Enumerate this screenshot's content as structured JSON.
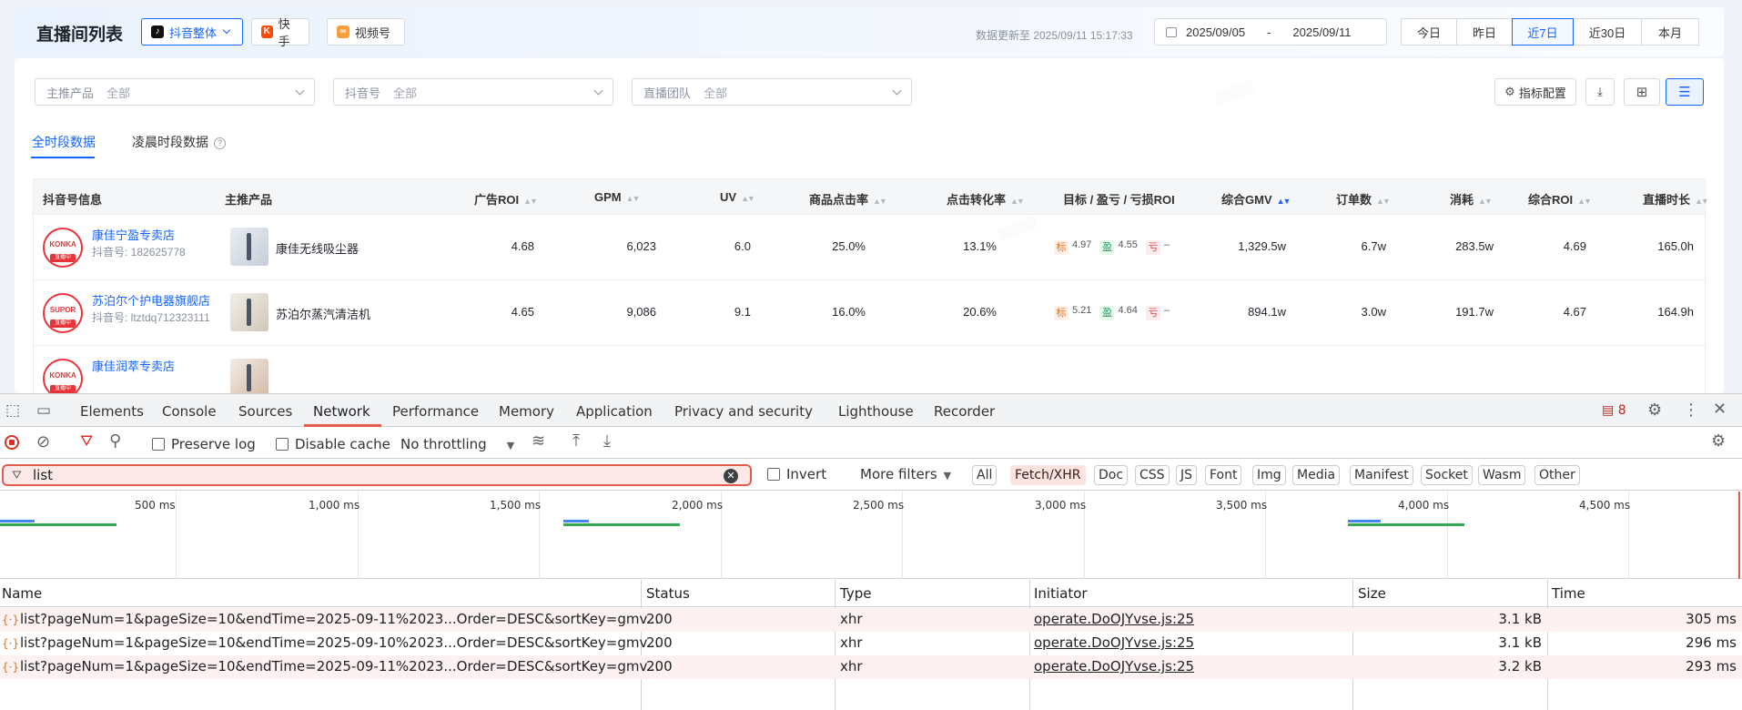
{
  "header": {
    "title": "直播间列表",
    "platforms": [
      {
        "label": "抖音整体",
        "icon": "douyin-icon",
        "color": "#111111"
      },
      {
        "label": "快手",
        "icon": "kuaishou-icon",
        "color": "#ff4906"
      },
      {
        "label": "视频号",
        "icon": "channels-icon",
        "color": "#fa9d3b"
      }
    ],
    "update_text": "数据更新至 2025/09/11 15:17:33",
    "date_start": "2025/09/05",
    "date_sep": "-",
    "date_end": "2025/09/11",
    "ranges": [
      "今日",
      "昨日",
      "近7日",
      "近30日",
      "本月"
    ],
    "active_range": "近7日"
  },
  "filters": [
    {
      "label": "主推产品",
      "value": "全部"
    },
    {
      "label": "抖音号",
      "value": "全部"
    },
    {
      "label": "直播团队",
      "value": "全部"
    }
  ],
  "toolbar": {
    "metric_config": "指标配置"
  },
  "tabs": [
    "全时段数据",
    "凌晨时段数据"
  ],
  "table": {
    "columns": [
      "抖音号信息",
      "主推产品",
      "广告ROI",
      "GPM",
      "UV",
      "商品点击率",
      "点击转化率",
      "目标 / 盈亏 / 亏损ROI",
      "综合GMV",
      "订单数",
      "消耗",
      "综合ROI",
      "直播时长"
    ],
    "rows": [
      {
        "logo": "KONKA",
        "logo_badge": "直播中",
        "name": "康佳宁盈专卖店",
        "id": "抖音号: 182625778",
        "product": "康佳无线吸尘器",
        "ad_roi": "4.68",
        "gpm": "6,023",
        "uv": "6.0",
        "ctr": "25.0%",
        "cvr": "13.1%",
        "t_label": "标",
        "t_val": "4.97",
        "y_label": "盈",
        "y_val": "4.55",
        "k_label": "亏",
        "k_val": "–",
        "gmv": "1,329.5w",
        "orders": "6.7w",
        "spend": "283.5w",
        "roi": "4.69",
        "duration": "165.0h"
      },
      {
        "logo": "SUPOR",
        "logo_badge": "直播中",
        "name": "苏泊尔个护电器旗舰店",
        "id": "抖音号: ltztdq712323111",
        "product": "苏泊尔蒸汽清洁机",
        "ad_roi": "4.65",
        "gpm": "9,086",
        "uv": "9.1",
        "ctr": "16.0%",
        "cvr": "20.6%",
        "t_label": "标",
        "t_val": "5.21",
        "y_label": "盈",
        "y_val": "4.64",
        "k_label": "亏",
        "k_val": "–",
        "gmv": "894.1w",
        "orders": "3.0w",
        "spend": "191.7w",
        "roi": "4.67",
        "duration": "164.9h"
      },
      {
        "logo": "KONKA",
        "logo_badge": "直播中",
        "name": "康佳润萃专卖店",
        "id": "",
        "product": "",
        "ad_roi": "",
        "gpm": "",
        "uv": "",
        "ctr": "",
        "cvr": "",
        "t_label": "",
        "t_val": "",
        "y_label": "",
        "y_val": "",
        "k_label": "",
        "k_val": "",
        "gmv": "",
        "orders": "",
        "spend": "",
        "roi": "",
        "duration": ""
      }
    ]
  },
  "devtools": {
    "tabs": [
      "Elements",
      "Console",
      "Sources",
      "Network",
      "Performance",
      "Memory",
      "Application",
      "Privacy and security",
      "Lighthouse",
      "Recorder"
    ],
    "active_tab": "Network",
    "issues_count": "8",
    "preserve_log": "Preserve log",
    "disable_cache": "Disable cache",
    "throttling": "No throttling",
    "filter_value": "list",
    "invert": "Invert",
    "more_filters": "More filters",
    "type_filters": [
      "All",
      "Fetch/XHR",
      "Doc",
      "CSS",
      "JS",
      "Font",
      "Img",
      "Media",
      "Manifest",
      "Socket",
      "Wasm",
      "Other"
    ],
    "active_filter": "Fetch/XHR",
    "timeline_ticks": [
      "500 ms",
      "1,000 ms",
      "1,500 ms",
      "2,000 ms",
      "2,500 ms",
      "3,000 ms",
      "3,500 ms",
      "4,000 ms",
      "4,500 ms"
    ],
    "columns": [
      "Name",
      "Status",
      "Type",
      "Initiator",
      "Size",
      "Time"
    ],
    "requests": [
      {
        "name": "list?pageNum=1&pageSize=10&endTime=2025-09-11%2023...Order=DESC&sortKey=gmv...",
        "status": "200",
        "type": "xhr",
        "initiator": "operate.DoOJYvse.js:25",
        "size": "3.1 kB",
        "time": "305 ms"
      },
      {
        "name": "list?pageNum=1&pageSize=10&endTime=2025-09-10%2023...Order=DESC&sortKey=gmv...",
        "status": "200",
        "type": "xhr",
        "initiator": "operate.DoOJYvse.js:25",
        "size": "3.1 kB",
        "time": "296 ms"
      },
      {
        "name": "list?pageNum=1&pageSize=10&endTime=2025-09-11%2023...Order=DESC&sortKey=gmv...",
        "status": "200",
        "type": "xhr",
        "initiator": "operate.DoOJYvse.js:25",
        "size": "3.2 kB",
        "time": "293 ms"
      }
    ]
  },
  "colors": {
    "accent": "#1664ff",
    "devtools_accent": "#e35d4f",
    "brand_red": "#e6343a"
  }
}
